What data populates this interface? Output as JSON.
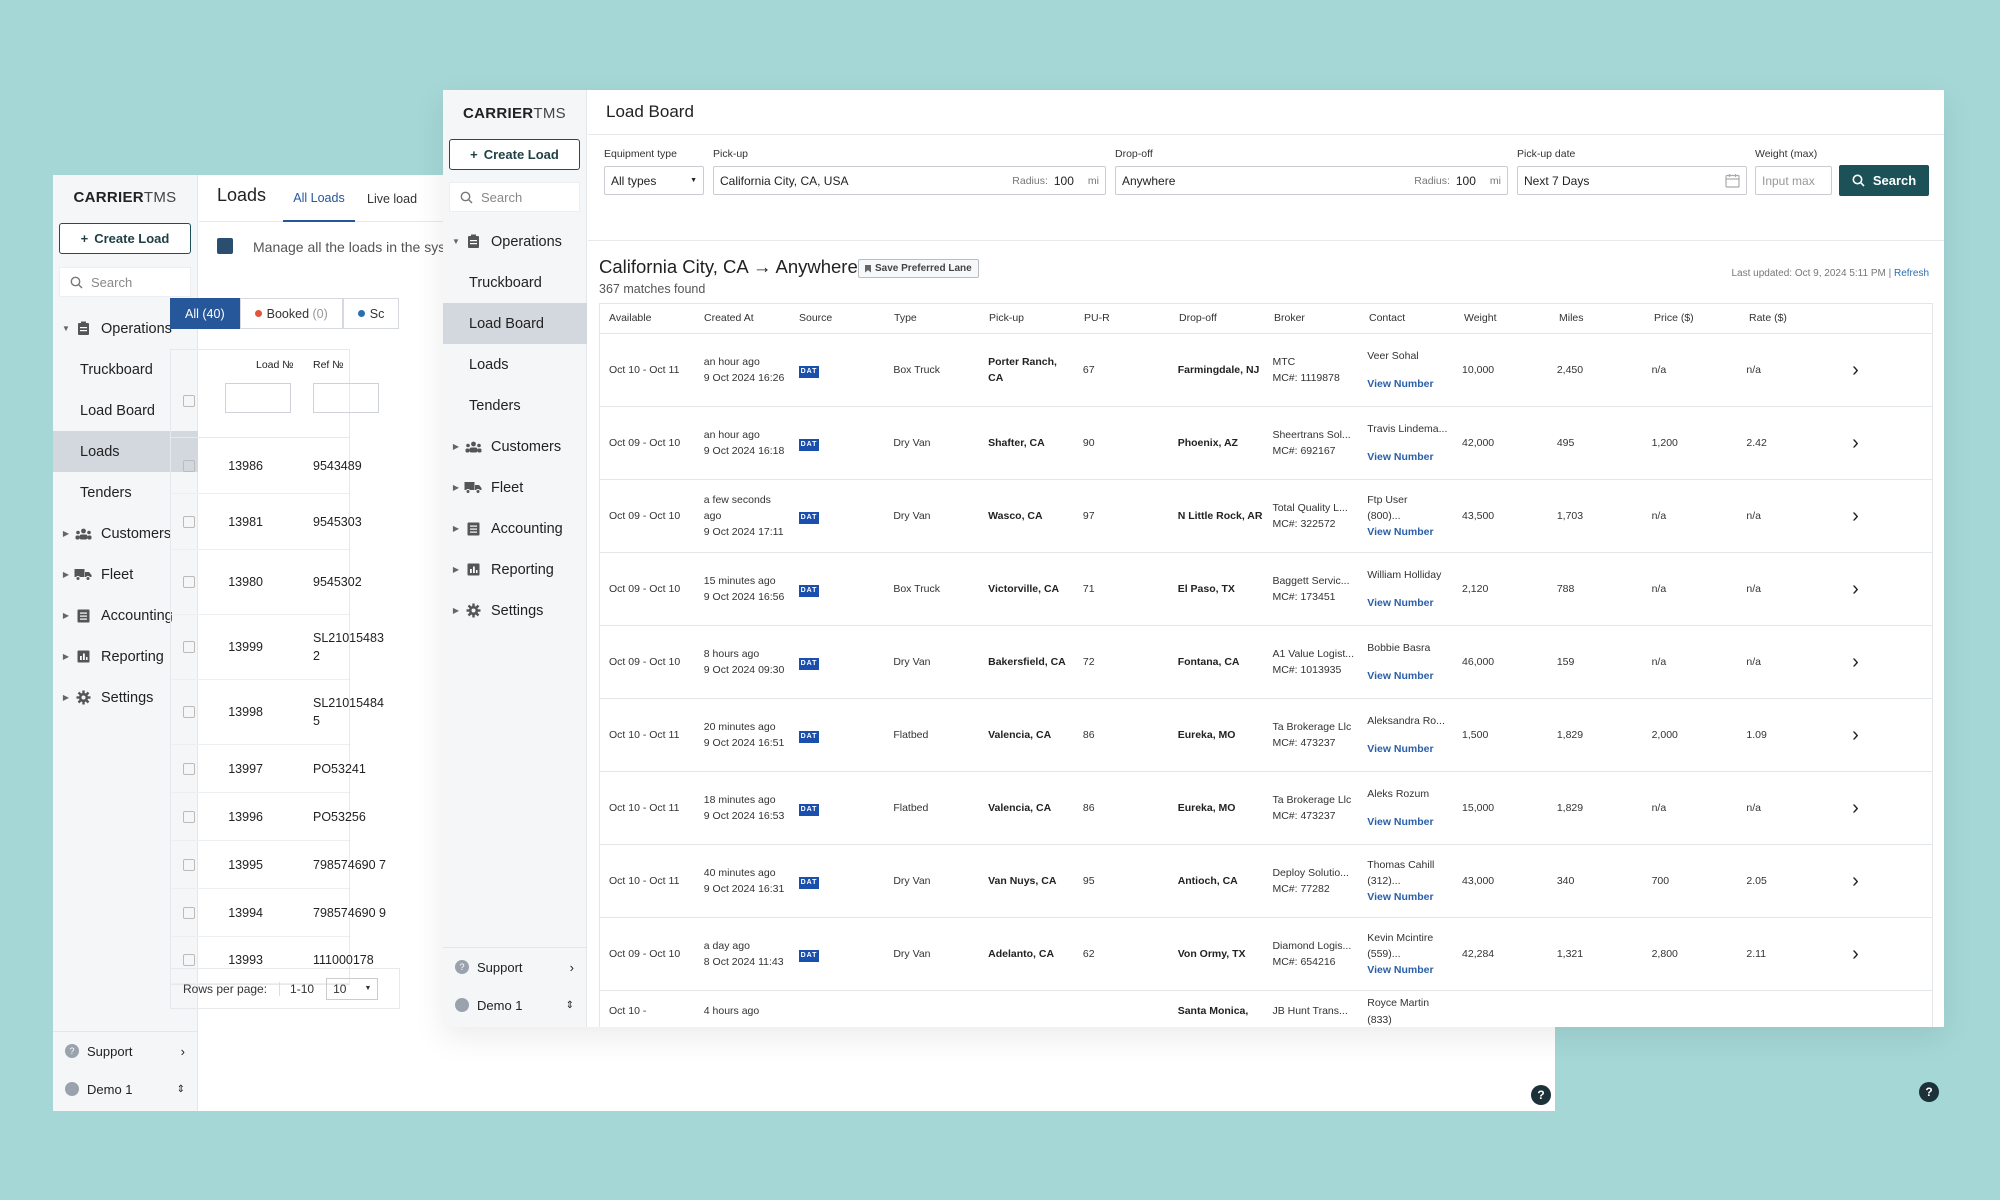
{
  "back": {
    "logo_bold": "CARRIER",
    "logo_thin": "TMS",
    "create_label": "Create Load",
    "search_placeholder": "Search",
    "nav_operations": "Operations",
    "ops_items": [
      "Truckboard",
      "Load Board",
      "Loads",
      "Tenders"
    ],
    "active_item": "Loads",
    "nav_sections": [
      "Customers",
      "Fleet",
      "Accounting",
      "Reporting",
      "Settings"
    ],
    "support": "Support",
    "user": "Demo 1",
    "page_title": "Loads",
    "tabs": [
      "All Loads",
      "Live load"
    ],
    "subtitle": "Manage all the loads in the syst",
    "filter_all": "All",
    "filter_all_count": "(40)",
    "filter_booked": "Booked",
    "filter_booked_count": "(0)",
    "filter_third": "Sc",
    "col_load": "Load №",
    "col_ref": "Ref №",
    "rows": [
      {
        "load": "13986",
        "ref": "9543489"
      },
      {
        "load": "13981",
        "ref": "9545303"
      },
      {
        "load": "13980",
        "ref": "9545302"
      },
      {
        "load": "13999",
        "ref": "SL21015483 2"
      },
      {
        "load": "13998",
        "ref": "SL21015484 5"
      },
      {
        "load": "13997",
        "ref": "PO53241"
      },
      {
        "load": "13996",
        "ref": "PO53256"
      },
      {
        "load": "13995",
        "ref": "798574690 7"
      },
      {
        "load": "13994",
        "ref": "798574690 9"
      },
      {
        "load": "13993",
        "ref": "111000178"
      }
    ],
    "rows_per_page_label": "Rows per page:",
    "range": "1-10",
    "page_size": "10"
  },
  "front": {
    "logo_bold": "CARRIER",
    "logo_thin": "TMS",
    "create_label": "Create Load",
    "search_placeholder": "Search",
    "nav_operations": "Operations",
    "ops_items": [
      "Truckboard",
      "Load Board",
      "Loads",
      "Tenders"
    ],
    "active_item": "Load Board",
    "nav_sections": [
      "Customers",
      "Fleet",
      "Accounting",
      "Reporting",
      "Settings"
    ],
    "support": "Support",
    "user": "Demo 1",
    "page_title": "Load Board",
    "filters": {
      "equipment_label": "Equipment type",
      "equipment_value": "All types",
      "pickup_label": "Pick-up",
      "pickup_value": "California City, CA, USA",
      "pickup_radius_label": "Radius:",
      "pickup_radius": "100",
      "pickup_unit": "mi",
      "dropoff_label": "Drop-off",
      "dropoff_value": "Anywhere",
      "dropoff_radius_label": "Radius:",
      "dropoff_radius": "100",
      "dropoff_unit": "mi",
      "date_label": "Pick-up date",
      "date_value": "Next 7 Days",
      "weight_label": "Weight (max)",
      "weight_placeholder": "Input max",
      "search_label": "Search"
    },
    "results_title": "California City, CA → Anywhere",
    "save_lane_label": "Save Preferred Lane",
    "matches": "367 matches found",
    "updated_text": "Last updated: Oct 9, 2024 5:11 PM |",
    "refresh_label": "Refresh",
    "columns": [
      "Available",
      "Created At",
      "Source",
      "Type",
      "Pick-up",
      "PU-R",
      "Drop-off",
      "Broker",
      "Contact",
      "Weight",
      "Miles",
      "Price ($)",
      "Rate ($)"
    ],
    "source_badge": "DAT",
    "rows": [
      {
        "avail": "Oct 10 - Oct 11",
        "ago": "an hour ago",
        "created": "9 Oct 2024 16:26",
        "type": "Box Truck",
        "pickup": "Porter Ranch, CA",
        "pur": "67",
        "dropoff": "Farmingdale, NJ",
        "broker": "MTC",
        "mc": "MC#: 1119878",
        "contact": "Veer Sohal",
        "phone": "",
        "vn": "View Number",
        "weight": "10,000",
        "miles": "2,450",
        "price": "n/a",
        "rate": "n/a"
      },
      {
        "avail": "Oct 09 - Oct 10",
        "ago": "an hour ago",
        "created": "9 Oct 2024 16:18",
        "type": "Dry Van",
        "pickup": "Shafter, CA",
        "pur": "90",
        "dropoff": "Phoenix, AZ",
        "broker": "Sheertrans Sol...",
        "mc": "MC#: 692167",
        "contact": "Travis Lindema...",
        "phone": "",
        "vn": "View Number",
        "weight": "42,000",
        "miles": "495",
        "price": "1,200",
        "rate": "2.42"
      },
      {
        "avail": "Oct 09 - Oct 10",
        "ago": "a few seconds ago",
        "created": "9 Oct 2024 17:11",
        "type": "Dry Van",
        "pickup": "Wasco, CA",
        "pur": "97",
        "dropoff": "N Little Rock, AR",
        "broker": "Total Quality L...",
        "mc": "MC#: 322572",
        "contact": "Ftp User",
        "phone": "(800)...",
        "vn": "View Number",
        "weight": "43,500",
        "miles": "1,703",
        "price": "n/a",
        "rate": "n/a"
      },
      {
        "avail": "Oct 09 - Oct 10",
        "ago": "15 minutes ago",
        "created": "9 Oct 2024 16:56",
        "type": "Box Truck",
        "pickup": "Victorville, CA",
        "pur": "71",
        "dropoff": "El Paso, TX",
        "broker": "Baggett Servic...",
        "mc": "MC#: 173451",
        "contact": "William Holliday",
        "phone": "",
        "vn": "View Number",
        "weight": "2,120",
        "miles": "788",
        "price": "n/a",
        "rate": "n/a"
      },
      {
        "avail": "Oct 09 - Oct 10",
        "ago": "8 hours ago",
        "created": "9 Oct 2024 09:30",
        "type": "Dry Van",
        "pickup": "Bakersfield, CA",
        "pur": "72",
        "dropoff": "Fontana, CA",
        "broker": "A1 Value Logist...",
        "mc": "MC#: 1013935",
        "contact": "Bobbie Basra",
        "phone": "",
        "vn": "View Number",
        "weight": "46,000",
        "miles": "159",
        "price": "n/a",
        "rate": "n/a"
      },
      {
        "avail": "Oct 10 - Oct 11",
        "ago": "20 minutes ago",
        "created": "9 Oct 2024 16:51",
        "type": "Flatbed",
        "pickup": "Valencia, CA",
        "pur": "86",
        "dropoff": "Eureka, MO",
        "broker": "Ta Brokerage Llc",
        "mc": "MC#: 473237",
        "contact": "Aleksandra Ro...",
        "phone": "",
        "vn": "View Number",
        "weight": "1,500",
        "miles": "1,829",
        "price": "2,000",
        "rate": "1.09"
      },
      {
        "avail": "Oct 10 - Oct 11",
        "ago": "18 minutes ago",
        "created": "9 Oct 2024 16:53",
        "type": "Flatbed",
        "pickup": "Valencia, CA",
        "pur": "86",
        "dropoff": "Eureka, MO",
        "broker": "Ta Brokerage Llc",
        "mc": "MC#: 473237",
        "contact": "Aleks Rozum",
        "phone": "",
        "vn": "View Number",
        "weight": "15,000",
        "miles": "1,829",
        "price": "n/a",
        "rate": "n/a"
      },
      {
        "avail": "Oct 10 - Oct 11",
        "ago": "40 minutes ago",
        "created": "9 Oct 2024 16:31",
        "type": "Dry Van",
        "pickup": "Van Nuys, CA",
        "pur": "95",
        "dropoff": "Antioch, CA",
        "broker": "Deploy Solutio...",
        "mc": "MC#: 77282",
        "contact": "Thomas Cahill",
        "phone": "(312)...",
        "vn": "View Number",
        "weight": "43,000",
        "miles": "340",
        "price": "700",
        "rate": "2.05"
      },
      {
        "avail": "Oct 09 - Oct 10",
        "ago": "a day ago",
        "created": "8 Oct 2024 11:43",
        "type": "Dry Van",
        "pickup": "Adelanto, CA",
        "pur": "62",
        "dropoff": "Von Ormy, TX",
        "broker": "Diamond Logis...",
        "mc": "MC#: 654216",
        "contact": "Kevin Mcintire",
        "phone": "(559)...",
        "vn": "View Number",
        "weight": "42,284",
        "miles": "1,321",
        "price": "2,800",
        "rate": "2.11"
      },
      {
        "avail": "Oct 10 -",
        "ago": "4 hours ago",
        "created": "",
        "type": "",
        "pickup": "",
        "pur": "",
        "dropoff": "Santa Monica,",
        "broker": "JB Hunt Trans...",
        "mc": "",
        "contact": "Royce Martin",
        "phone": "(833)",
        "vn": "",
        "weight": "",
        "miles": "",
        "price": "",
        "rate": ""
      }
    ]
  },
  "colors": {
    "background": "#a4d7d6",
    "accent": "#1c5157",
    "link": "#2a5fa8",
    "active_nav": "#d2d8de"
  }
}
